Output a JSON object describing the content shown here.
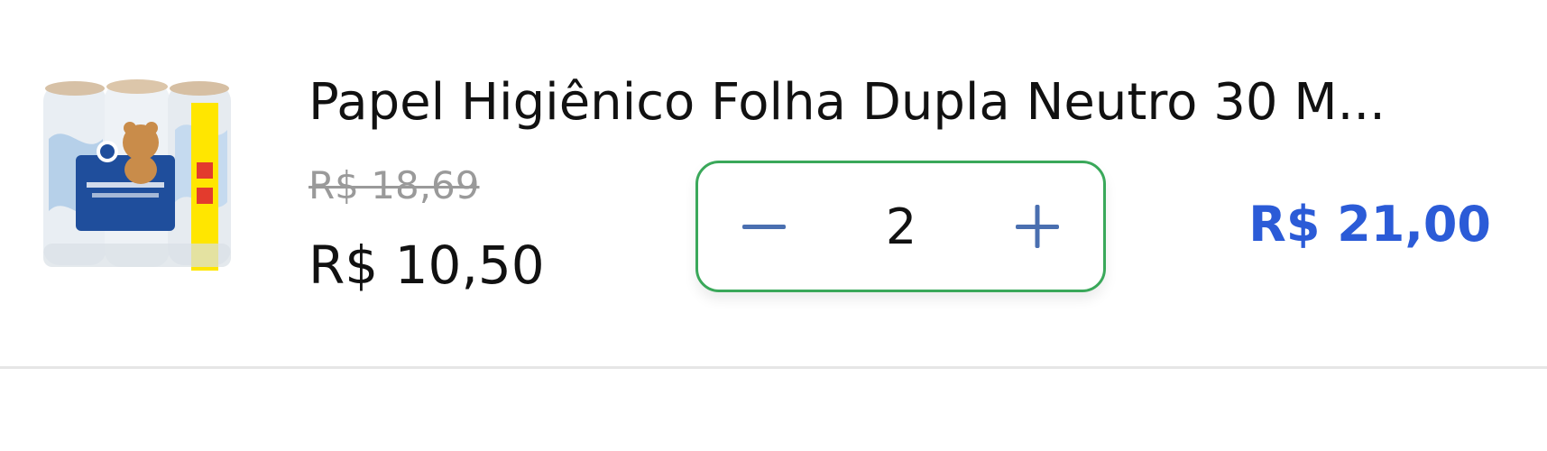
{
  "cart_item": {
    "title": "Papel Higiênico Folha Dupla Neutro 30 M...",
    "old_price": "R$ 18,69",
    "unit_price": "R$ 10,50",
    "quantity": "2",
    "total_price": "R$ 21,00",
    "icons": {
      "decrease": "minus-icon",
      "increase": "plus-icon"
    },
    "colors": {
      "total_price": "#2b5bd7",
      "stepper_border": "#3aa85a",
      "stepper_icons": "#4a6fb0",
      "old_price": "#9a9a9a"
    }
  }
}
